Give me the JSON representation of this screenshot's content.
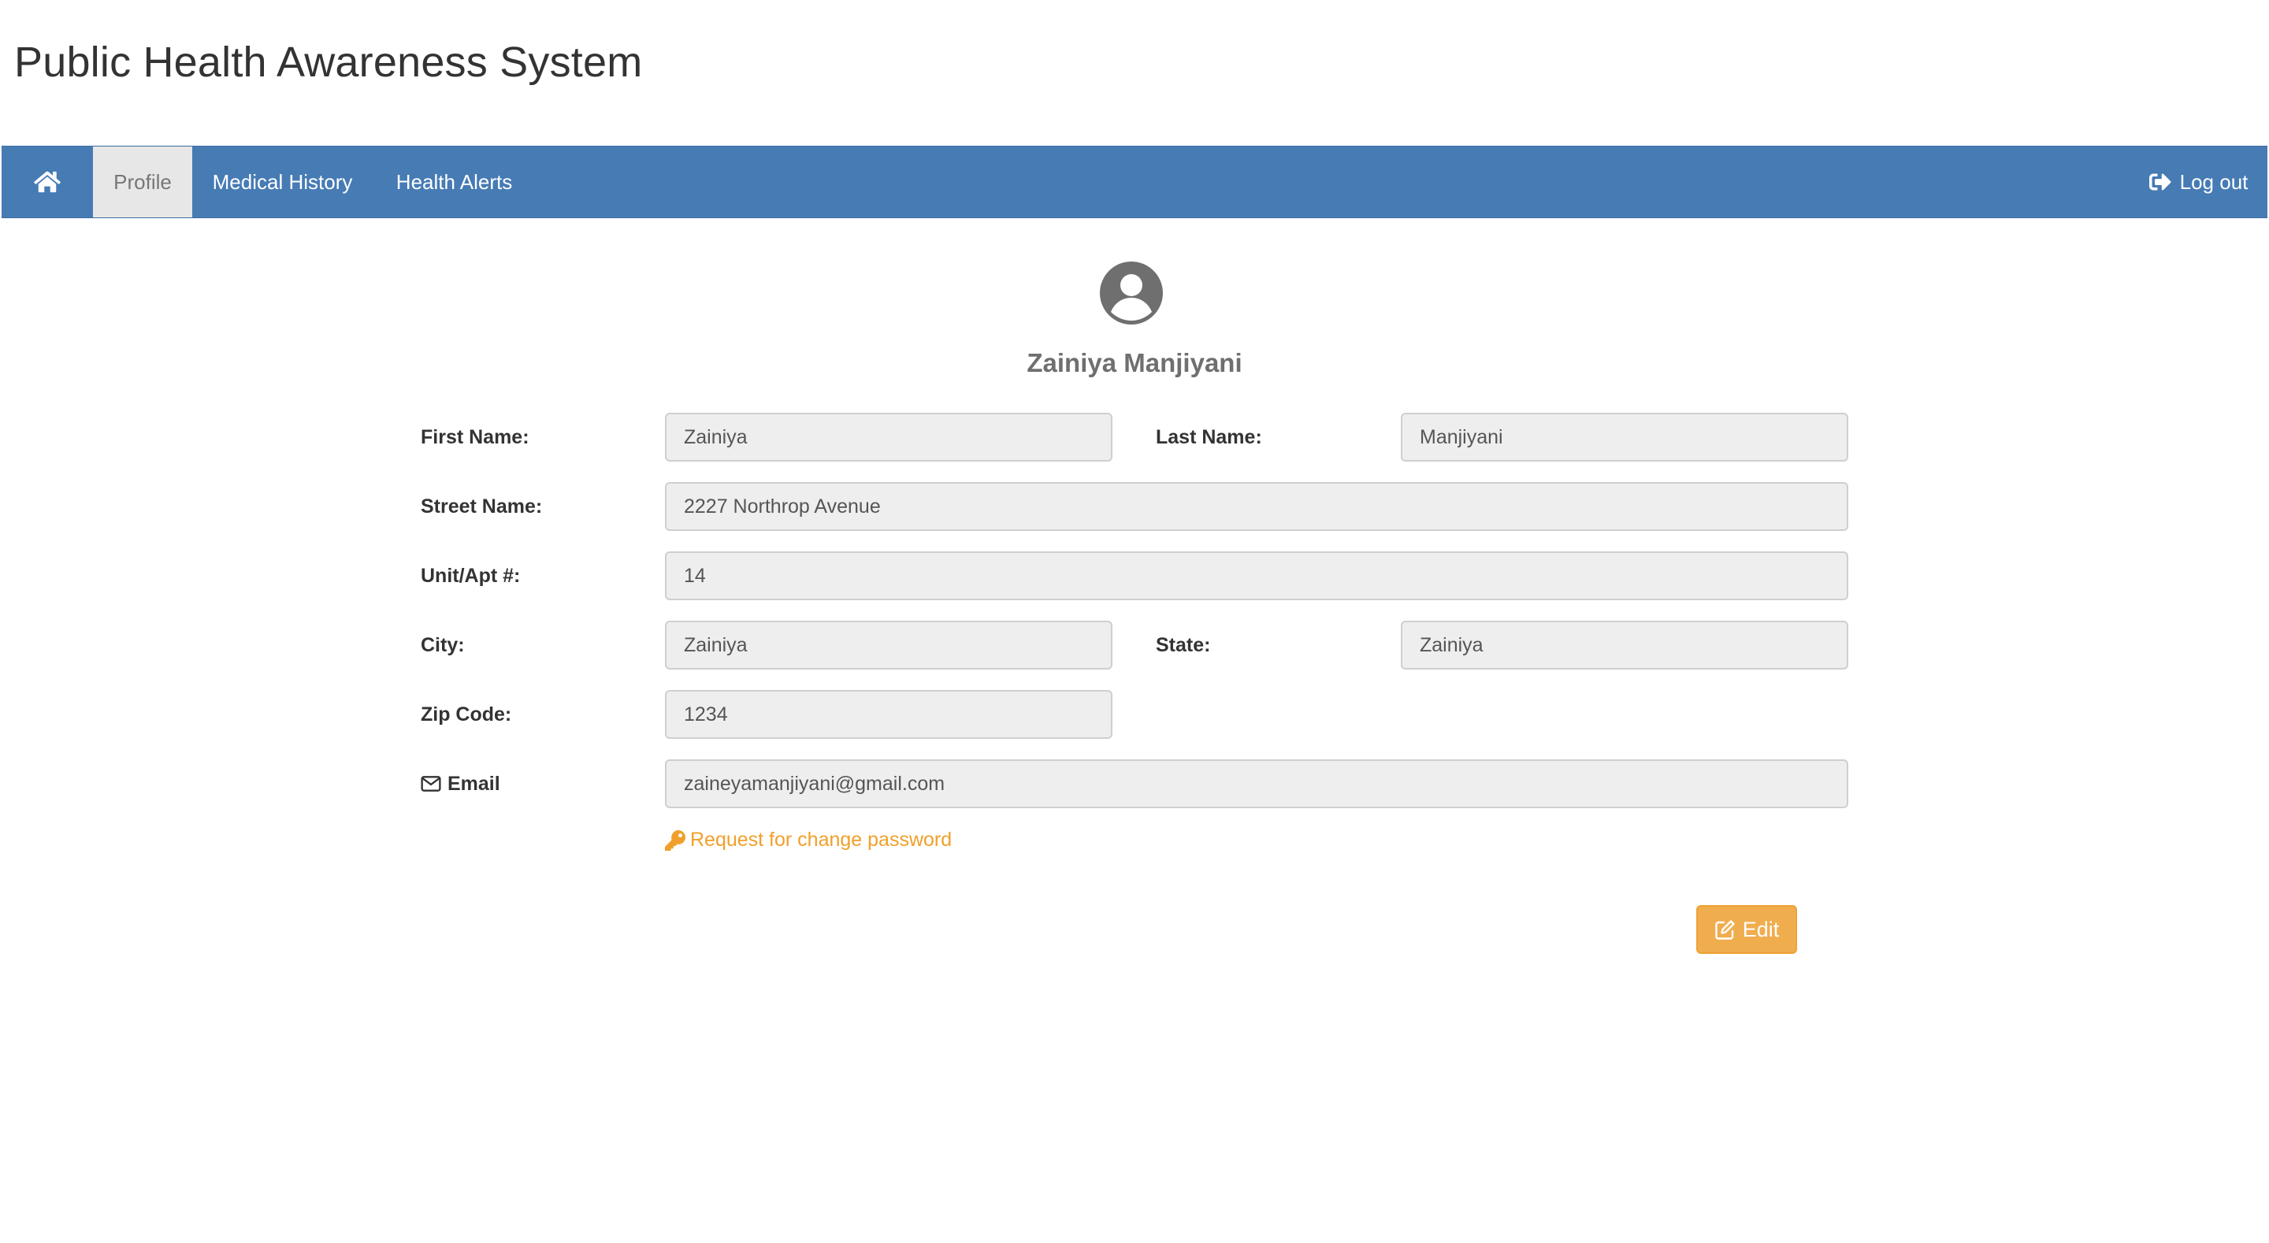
{
  "app": {
    "title": "Public Health Awareness System"
  },
  "nav": {
    "home_icon": "home-icon",
    "items": [
      {
        "label": "Profile",
        "active": true
      },
      {
        "label": "Medical History",
        "active": false
      },
      {
        "label": "Health Alerts",
        "active": false
      }
    ],
    "logout": {
      "label": "Log out",
      "icon": "sign-out-icon"
    }
  },
  "profile": {
    "avatar_icon": "user-circle-icon",
    "full_name": "Zainiya Manjiyani",
    "fields": {
      "first_name": {
        "label": "First Name:",
        "value": "Zainiya"
      },
      "last_name": {
        "label": "Last Name:",
        "value": "Manjiyani"
      },
      "street_name": {
        "label": "Street Name:",
        "value": "2227 Northrop Avenue"
      },
      "unit_apt": {
        "label": "Unit/Apt #:",
        "value": "14"
      },
      "city": {
        "label": "City:",
        "value": "Zainiya"
      },
      "state": {
        "label": "State:",
        "value": "Zainiya"
      },
      "zip_code": {
        "label": "Zip Code:",
        "value": "1234"
      },
      "email": {
        "label": "Email",
        "value": "zaineyamanjiyani@gmail.com",
        "icon": "envelope-icon"
      }
    },
    "change_password": {
      "label": "Request for change password",
      "icon": "key-icon"
    },
    "edit_button": {
      "label": "Edit",
      "icon": "edit-icon"
    }
  },
  "colors": {
    "navbar": "#467bb4",
    "active_tab": "#e7e7e7",
    "accent_orange": "#f0ad4e",
    "link_orange": "#f0a02a",
    "field_bg": "#eeeeee"
  }
}
